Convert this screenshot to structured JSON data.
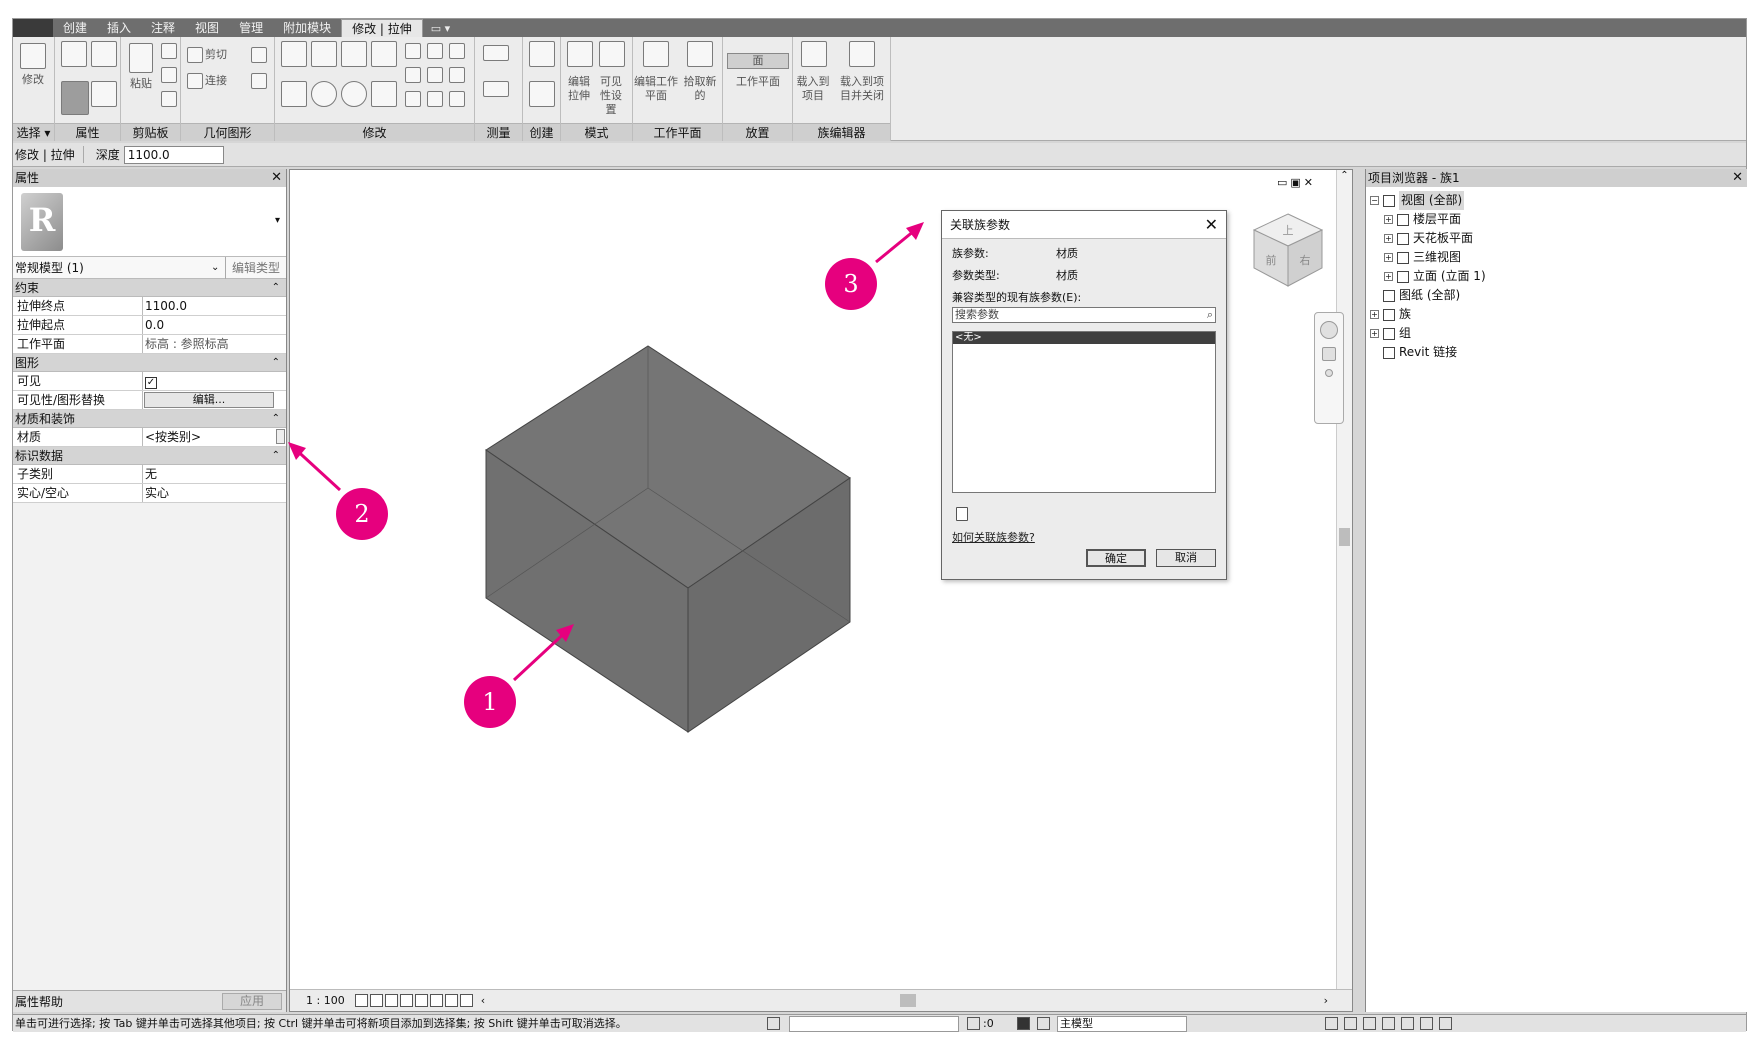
{
  "menu": {
    "tabs": [
      "创建",
      "插入",
      "注释",
      "视图",
      "管理",
      "附加模块",
      "修改 | 拉伸"
    ],
    "active_tab": "修改 | 拉伸"
  },
  "ribbon": {
    "groups": [
      "选择",
      "属性",
      "剪贴板",
      "几何图形",
      "修改",
      "测量",
      "创建",
      "模式",
      "工作平面",
      "放置",
      "族编辑器"
    ],
    "select_label": "选择 ▾",
    "modify_label": "修改",
    "paste_label": "粘贴",
    "cut_label": "剪切",
    "join_label": "连接",
    "edit_extrusion_label": "编辑拉伸",
    "visibility_settings_label": "可见性设置",
    "edit_workplane_label": "编辑工作平面",
    "pick_new_label": "拾取新的",
    "face_label": "面",
    "workplane_label": "工作平面",
    "load_into_project_label": "载入到项目",
    "load_close_label": "载入到项目并关闭"
  },
  "options_bar": {
    "context": "修改 | 拉伸",
    "depth_label": "深度",
    "depth_value": "1100.0"
  },
  "properties": {
    "title": "属性",
    "type_name": "常规模型 (1)",
    "edit_type": "编辑类型",
    "sections": {
      "constraints": "约束",
      "graphics": "图形",
      "materials": "材质和装饰",
      "identity": "标识数据"
    },
    "rows": {
      "extrusion_end": {
        "name": "拉伸终点",
        "value": "1100.0"
      },
      "extrusion_start": {
        "name": "拉伸起点",
        "value": "0.0"
      },
      "work_plane": {
        "name": "工作平面",
        "value": "标高 : 参照标高"
      },
      "visible": {
        "name": "可见",
        "value": "✓"
      },
      "vis_override": {
        "name": "可见性/图形替换",
        "value": "编辑..."
      },
      "material": {
        "name": "材质",
        "value": "<按类别>"
      },
      "subcategory": {
        "name": "子类别",
        "value": "无"
      },
      "solid_void": {
        "name": "实心/空心",
        "value": "实心"
      }
    },
    "help": "属性帮助",
    "apply": "应用"
  },
  "viewport": {
    "scale": "1 : 100",
    "cube_faces": {
      "top": "上",
      "front": "前",
      "right": "右"
    }
  },
  "dialog": {
    "title": "关联族参数",
    "family_param_label": "族参数:",
    "family_param_value": "材质",
    "param_type_label": "参数类型:",
    "param_type_value": "材质",
    "compatible_label": "兼容类型的现有族参数(E):",
    "search_placeholder": "搜索参数",
    "list_items": [
      "<无>"
    ],
    "help_link": "如何关联族参数?",
    "ok": "确定",
    "cancel": "取消"
  },
  "browser": {
    "title": "项目浏览器 - 族1",
    "tree": [
      {
        "label": "视图 (全部)",
        "level": 0,
        "exp": "−"
      },
      {
        "label": "楼层平面",
        "level": 1,
        "exp": "+"
      },
      {
        "label": "天花板平面",
        "level": 1,
        "exp": "+"
      },
      {
        "label": "三维视图",
        "level": 1,
        "exp": "+"
      },
      {
        "label": "立面 (立面 1)",
        "level": 1,
        "exp": "+"
      },
      {
        "label": "图纸 (全部)",
        "level": 0,
        "exp": ""
      },
      {
        "label": "族",
        "level": 0,
        "exp": "+"
      },
      {
        "label": "组",
        "level": 0,
        "exp": "+"
      },
      {
        "label": "Revit 链接",
        "level": 0,
        "exp": ""
      }
    ]
  },
  "status": {
    "message": "单击可进行选择; 按 Tab 键并单击可选择其他项目; 按 Ctrl 键并单击可将新项目添加到选择集; 按 Shift 键并单击可取消选择。",
    "zero": ":0",
    "model": "主模型"
  },
  "annotations": [
    "1",
    "2",
    "3"
  ],
  "colors": {
    "accent": "#e6007e",
    "solid": "#737373"
  }
}
